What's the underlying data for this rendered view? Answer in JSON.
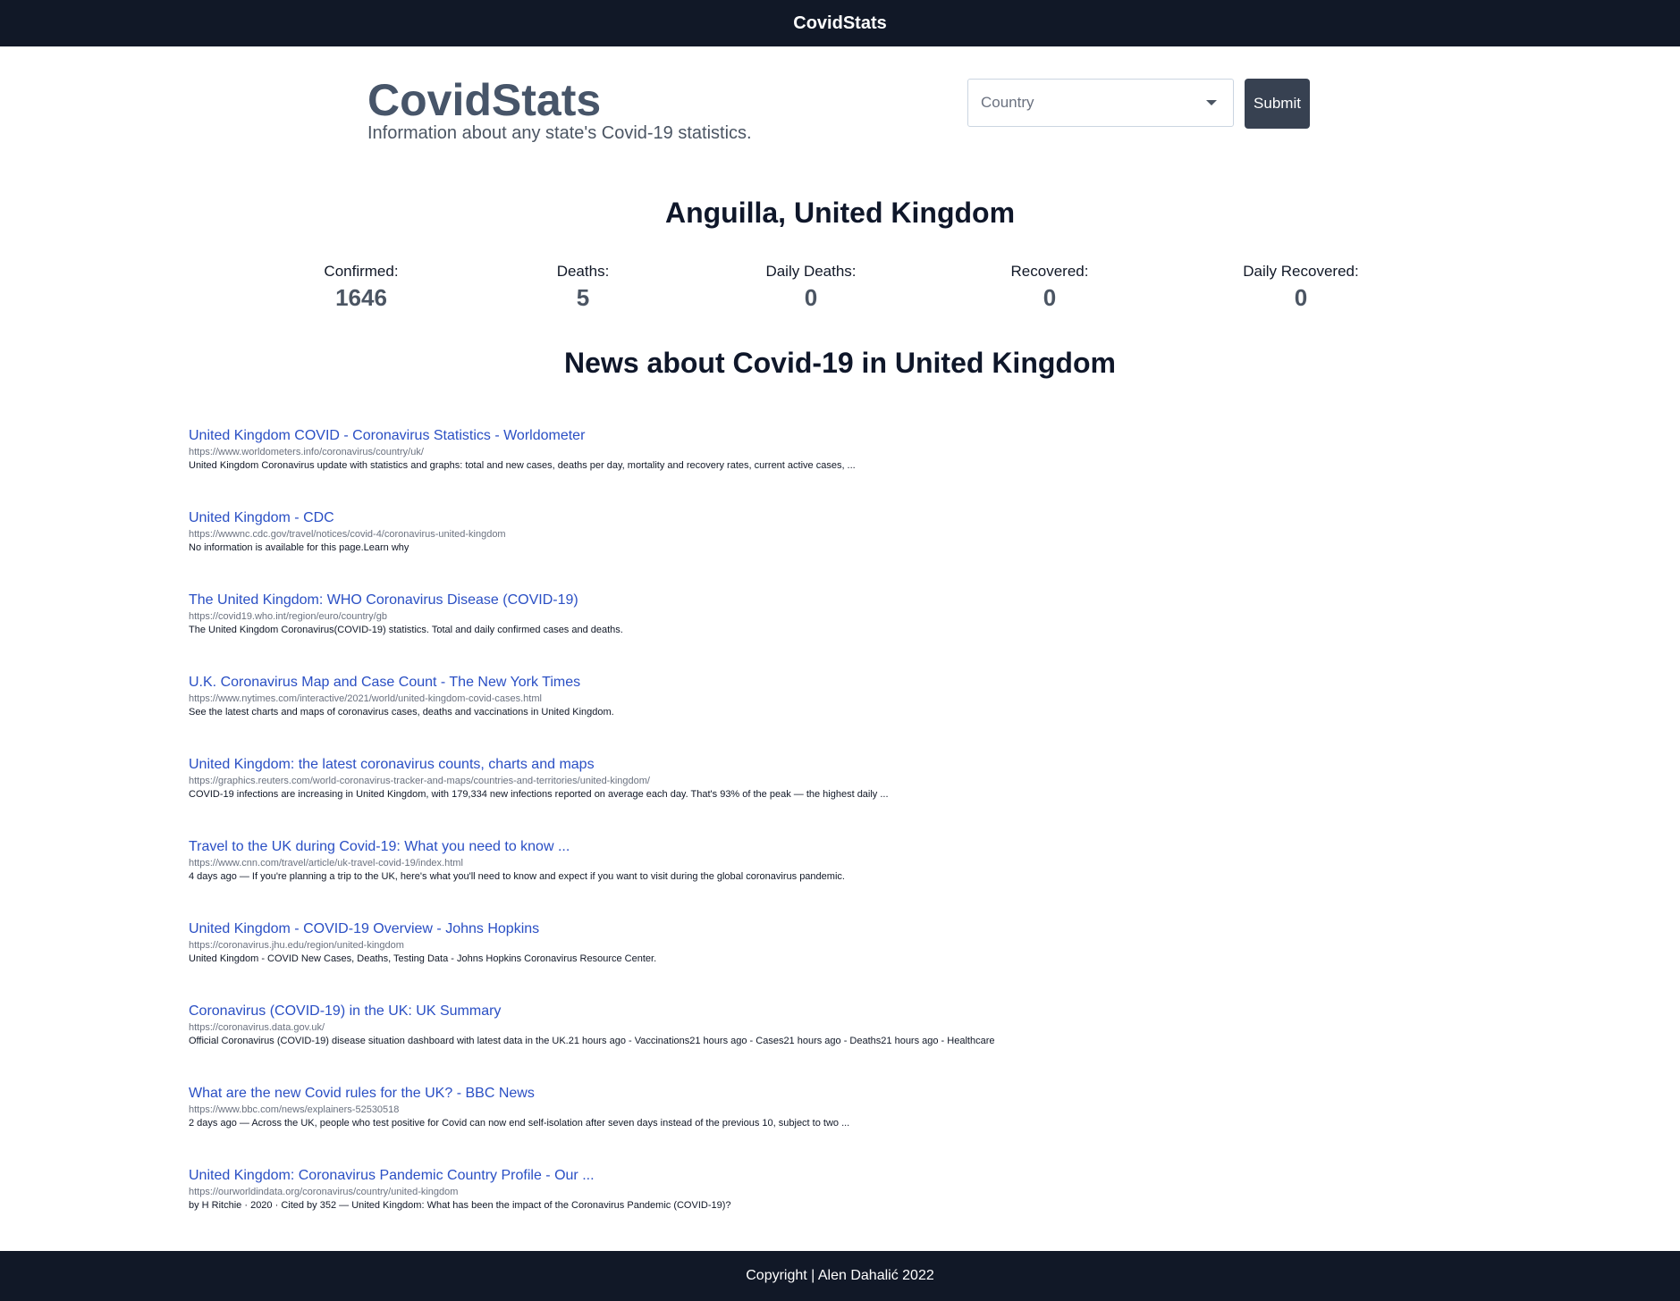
{
  "navbar": {
    "title": "CovidStats"
  },
  "brand": {
    "title": "CovidStats",
    "subtitle": "Information about any state's Covid-19 statistics."
  },
  "form": {
    "country_placeholder": "Country",
    "submit_label": "Submit"
  },
  "location": "Anguilla, United Kingdom",
  "stats": [
    {
      "label": "Confirmed:",
      "value": "1646"
    },
    {
      "label": "Deaths:",
      "value": "5"
    },
    {
      "label": "Daily Deaths:",
      "value": "0"
    },
    {
      "label": "Recovered:",
      "value": "0"
    },
    {
      "label": "Daily Recovered:",
      "value": "0"
    }
  ],
  "news": {
    "heading": "News about Covid-19 in United Kingdom",
    "items": [
      {
        "title": "United Kingdom COVID - Coronavirus Statistics - Worldometer",
        "url": "https://www.worldometers.info/coronavirus/country/uk/",
        "snippet": "United Kingdom Coronavirus update with statistics and graphs: total and new cases, deaths per day, mortality and recovery rates, current active cases, ..."
      },
      {
        "title": "United Kingdom - CDC",
        "url": "https://wwwnc.cdc.gov/travel/notices/covid-4/coronavirus-united-kingdom",
        "snippet": "No information is available for this page.Learn why"
      },
      {
        "title": "The United Kingdom: WHO Coronavirus Disease (COVID-19)",
        "url": "https://covid19.who.int/region/euro/country/gb",
        "snippet": "The United Kingdom Coronavirus(COVID-19) statistics. Total and daily confirmed cases and deaths."
      },
      {
        "title": "U.K. Coronavirus Map and Case Count - The New York Times",
        "url": "https://www.nytimes.com/interactive/2021/world/united-kingdom-covid-cases.html",
        "snippet": "See the latest charts and maps of coronavirus cases, deaths and vaccinations in United Kingdom."
      },
      {
        "title": "United Kingdom: the latest coronavirus counts, charts and maps",
        "url": "https://graphics.reuters.com/world-coronavirus-tracker-and-maps/countries-and-territories/united-kingdom/",
        "snippet": "COVID-19 infections are increasing in United Kingdom, with 179,334 new infections reported on average each day. That's 93% of the peak — the highest daily ..."
      },
      {
        "title": "Travel to the UK during Covid-19: What you need to know ...",
        "url": "https://www.cnn.com/travel/article/uk-travel-covid-19/index.html",
        "snippet": "4 days ago — If you're planning a trip to the UK, here's what you'll need to know and expect if you want to visit during the global coronavirus pandemic."
      },
      {
        "title": "United Kingdom - COVID-19 Overview - Johns Hopkins",
        "url": "https://coronavirus.jhu.edu/region/united-kingdom",
        "snippet": "United Kingdom - COVID New Cases, Deaths, Testing Data - Johns Hopkins Coronavirus Resource Center."
      },
      {
        "title": "Coronavirus (COVID-19) in the UK: UK Summary",
        "url": "https://coronavirus.data.gov.uk/",
        "snippet": "Official Coronavirus (COVID-19) disease situation dashboard with latest data in the UK.21 hours ago - Vaccinations21 hours ago - Cases21 hours ago - Deaths21 hours ago - Healthcare"
      },
      {
        "title": "What are the new Covid rules for the UK? - BBC News",
        "url": "https://www.bbc.com/news/explainers-52530518",
        "snippet": "2 days ago — Across the UK, people who test positive for Covid can now end self-isolation after seven days instead of the previous 10, subject to two ..."
      },
      {
        "title": "United Kingdom: Coronavirus Pandemic Country Profile - Our ...",
        "url": "https://ourworldindata.org/coronavirus/country/united-kingdom",
        "snippet": "by H Ritchie · 2020 · Cited by 352 — United Kingdom: What has been the impact of the Coronavirus Pandemic (COVID-19)?"
      }
    ]
  },
  "footer": {
    "text": "Copyright | Alen Dahalić 2022"
  }
}
